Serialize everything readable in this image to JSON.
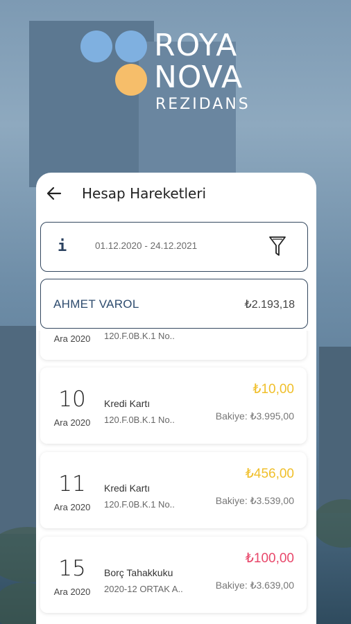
{
  "brand": {
    "line1": "ROYA",
    "line2": "NOVA",
    "line3": "REZIDANS",
    "colors": {
      "blue": "#7fb0e0",
      "orange": "#f6be6a"
    }
  },
  "header": {
    "title": "Hesap Hareketleri",
    "back_icon": "arrow-left-icon"
  },
  "filter": {
    "info_icon": "info-icon",
    "info_glyph": "i",
    "date_range": "01.12.2020 - 24.12.2021",
    "filter_icon": "funnel-icon"
  },
  "account": {
    "name": "AHMET VAROL",
    "balance": "₺2.193,18"
  },
  "transactions": [
    {
      "day": "",
      "month": "Ara 2020",
      "description": "",
      "reference": "120.F.0B.K.1 No..",
      "amount": "",
      "balance": "",
      "amount_color": "#f0bf2a"
    },
    {
      "day": "10",
      "month": "Ara 2020",
      "description": "Kredi Kartı",
      "reference": "120.F.0B.K.1 No..",
      "amount": "₺10,00",
      "balance": "Bakiye: ₺3.995,00",
      "amount_color": "#f0bf2a"
    },
    {
      "day": "11",
      "month": "Ara 2020",
      "description": "Kredi Kartı",
      "reference": "120.F.0B.K.1 No..",
      "amount": "₺456,00",
      "balance": "Bakiye: ₺3.539,00",
      "amount_color": "#f0bf2a"
    },
    {
      "day": "15",
      "month": "Ara 2020",
      "description": "Borç Tahakkuku",
      "reference": "2020-12 ORTAK A..",
      "amount": "₺100,00",
      "balance": "Bakiye: ₺3.639,00",
      "amount_color": "#e8476a"
    }
  ]
}
